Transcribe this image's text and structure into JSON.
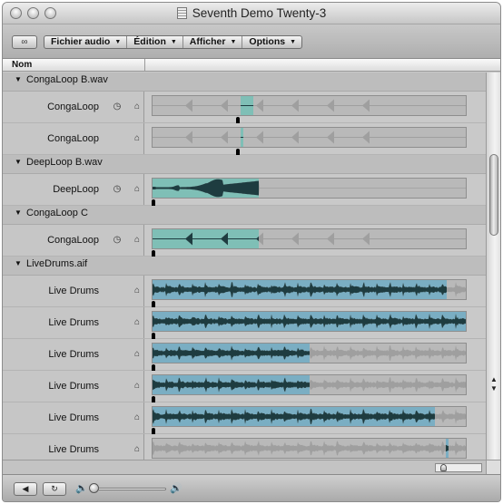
{
  "window": {
    "title": "Seventh Demo Twenty-3"
  },
  "toolbar": {
    "link_icon": "link-icon",
    "menus": [
      {
        "label": "Fichier audio"
      },
      {
        "label": "Édition"
      },
      {
        "label": "Afficher"
      },
      {
        "label": "Options"
      }
    ]
  },
  "columns": {
    "name_header": "Nom"
  },
  "colors": {
    "waveform_selected": "#7fbfb6",
    "waveform_loop": "#7aaec3",
    "waveform_dark": "#1e3c40",
    "waveform_unselected": "#9f9f9f"
  },
  "rows": [
    {
      "kind": "file",
      "label": "CongaLoop B.wav"
    },
    {
      "kind": "region",
      "label": "CongaLoop",
      "loop_icon": true,
      "lock_icon": true,
      "wave": "conga",
      "fill_start": 0.28,
      "fill_end": 0.32,
      "playhead": 0.27
    },
    {
      "kind": "region",
      "label": "CongaLoop",
      "loop_icon": false,
      "lock_icon": true,
      "wave": "conga",
      "fill_start": 0.28,
      "fill_end": 0.29,
      "playhead": 0.27
    },
    {
      "kind": "file",
      "label": "DeepLoop B.wav"
    },
    {
      "kind": "region",
      "label": "DeepLoop",
      "loop_icon": true,
      "lock_icon": true,
      "wave": "deep",
      "fill_start": 0.0,
      "fill_end": 0.34,
      "playhead": 0.0
    },
    {
      "kind": "file",
      "label": "CongaLoop C"
    },
    {
      "kind": "region",
      "label": "CongaLoop",
      "loop_icon": true,
      "lock_icon": true,
      "wave": "conga",
      "fill_start": 0.0,
      "fill_end": 0.34,
      "playhead": 0.0
    },
    {
      "kind": "file",
      "label": "LiveDrums.aif"
    },
    {
      "kind": "region",
      "label": "Live Drums",
      "loop_icon": false,
      "lock_icon": true,
      "wave": "drums",
      "fill_start": 0.0,
      "fill_end": 0.94,
      "playhead": 0.0
    },
    {
      "kind": "region",
      "label": "Live Drums",
      "loop_icon": false,
      "lock_icon": true,
      "wave": "drums",
      "fill_start": 0.0,
      "fill_end": 1.0,
      "playhead": 0.0
    },
    {
      "kind": "region",
      "label": "Live Drums",
      "loop_icon": false,
      "lock_icon": true,
      "wave": "drums",
      "fill_start": 0.0,
      "fill_end": 0.5,
      "playhead": 0.0
    },
    {
      "kind": "region",
      "label": "Live Drums",
      "loop_icon": false,
      "lock_icon": true,
      "wave": "drums",
      "fill_start": 0.0,
      "fill_end": 0.5,
      "playhead": 0.0
    },
    {
      "kind": "region",
      "label": "Live Drums",
      "loop_icon": false,
      "lock_icon": true,
      "wave": "drums",
      "fill_start": 0.0,
      "fill_end": 0.9,
      "playhead": 0.0
    },
    {
      "kind": "region",
      "label": "Live Drums",
      "loop_icon": false,
      "lock_icon": true,
      "wave": "drums",
      "fill_start": 0.935,
      "fill_end": 0.94,
      "playhead": 0.935
    }
  ],
  "transport": {
    "play_icon": "play-icon",
    "loop_icon": "loop-icon",
    "volume_low_icon": "speaker-low-icon",
    "volume_high_icon": "speaker-high-icon",
    "volume_level": 0.0
  }
}
